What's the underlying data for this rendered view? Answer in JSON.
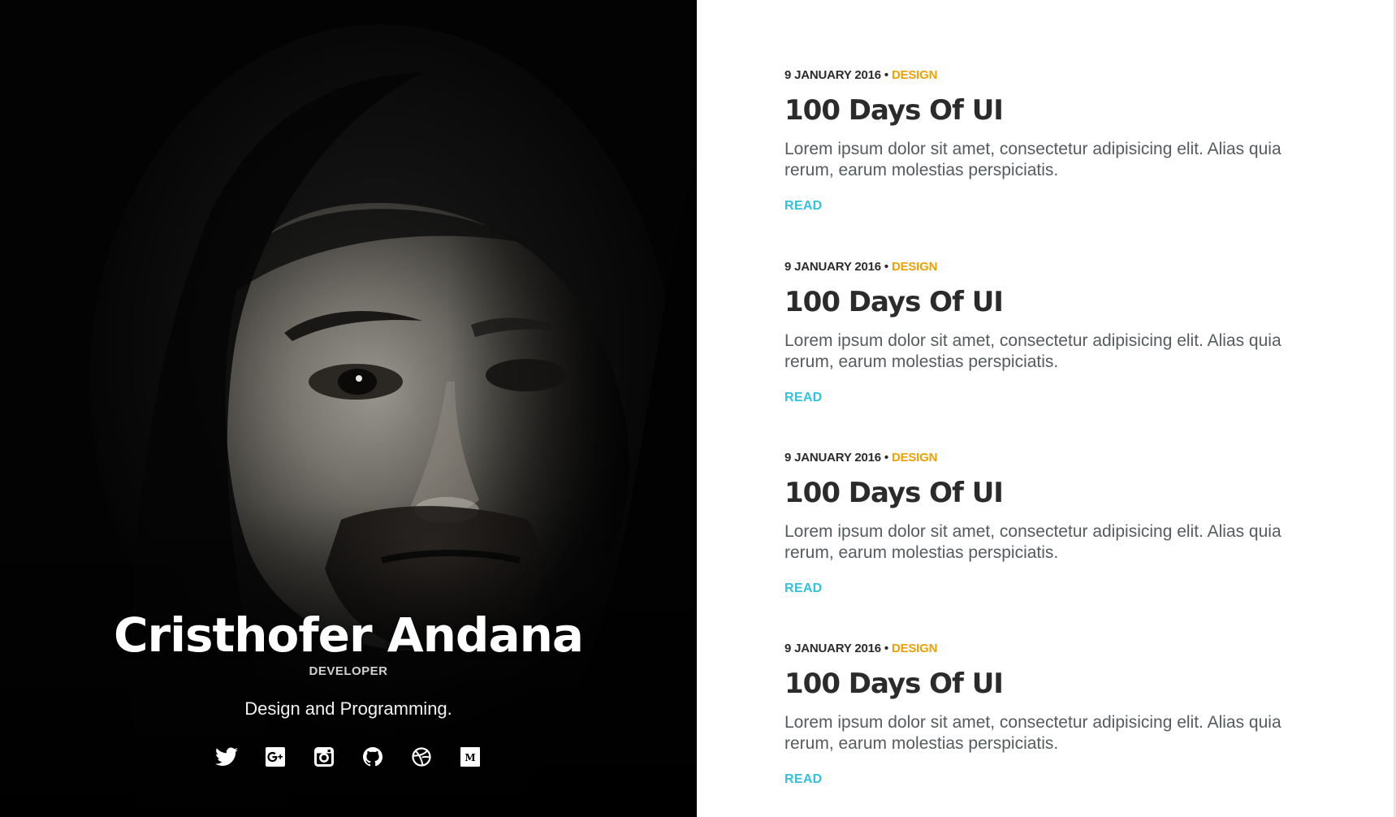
{
  "profile": {
    "name": "Cristhofer Andana",
    "role": "DEVELOPER",
    "tagline": "Design and Programming.",
    "social": [
      {
        "icon": "twitter-icon"
      },
      {
        "icon": "google-plus-icon"
      },
      {
        "icon": "instagram-icon"
      },
      {
        "icon": "github-icon"
      },
      {
        "icon": "dribbble-icon"
      },
      {
        "icon": "medium-icon"
      }
    ]
  },
  "posts": [
    {
      "date": "9 JANUARY 2016",
      "separator": "•",
      "category": "DESIGN",
      "title": "100 Days Of UI",
      "excerpt": "Lorem ipsum dolor sit amet, consectetur adipisicing elit. Alias quia rerum, earum molestias perspiciatis.",
      "read_label": "READ"
    },
    {
      "date": "9 JANUARY 2016",
      "separator": "•",
      "category": "DESIGN",
      "title": "100 Days Of UI",
      "excerpt": "Lorem ipsum dolor sit amet, consectetur adipisicing elit. Alias quia rerum, earum molestias perspiciatis.",
      "read_label": "READ"
    },
    {
      "date": "9 JANUARY 2016",
      "separator": "•",
      "category": "DESIGN",
      "title": "100 Days Of UI",
      "excerpt": "Lorem ipsum dolor sit amet, consectetur adipisicing elit. Alias quia rerum, earum molestias perspiciatis.",
      "read_label": "READ"
    },
    {
      "date": "9 JANUARY 2016",
      "separator": "•",
      "category": "DESIGN",
      "title": "100 Days Of UI",
      "excerpt": "Lorem ipsum dolor sit amet, consectetur adipisicing elit. Alias quia rerum, earum molestias perspiciatis.",
      "read_label": "READ"
    }
  ],
  "colors": {
    "hero_background": "#030303",
    "category": "#f0a000",
    "read_link": "#2fc3e0",
    "title": "#2b2b2b",
    "excerpt": "#555b5e"
  }
}
